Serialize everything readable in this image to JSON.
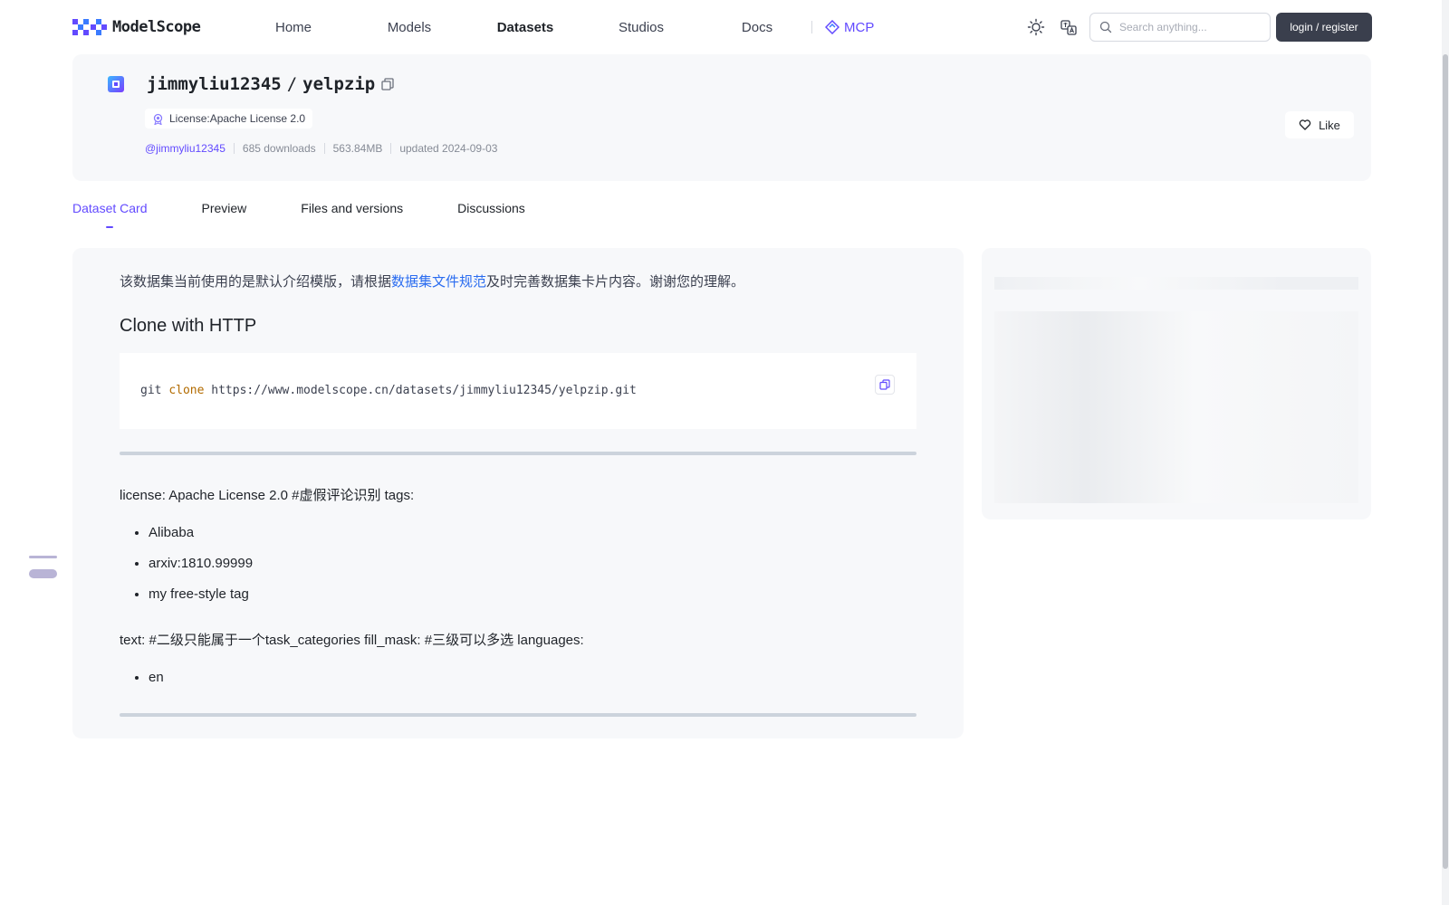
{
  "header": {
    "logo_text": "ModelScope",
    "nav": [
      "Home",
      "Models",
      "Datasets",
      "Studios",
      "Docs"
    ],
    "active_nav": "Datasets",
    "mcp_label": "MCP",
    "search_placeholder": "Search anything...",
    "login_label": "login / register"
  },
  "dataset": {
    "owner": "jimmyliu12345",
    "separator": "/",
    "name": "yelpzip",
    "license_tag": "License:Apache License 2.0",
    "author": "@jimmyliu12345",
    "downloads": "685 downloads",
    "size": "563.84MB",
    "updated": "updated 2024-09-03",
    "like_label": "Like"
  },
  "tabs": [
    "Dataset Card",
    "Preview",
    "Files and versions",
    "Discussions"
  ],
  "card": {
    "notice_before": "该数据集当前使用的是默认介绍模版，请根据",
    "notice_link": "数据集文件规范",
    "notice_after": "及时完善数据集卡片内容。谢谢您的理解。",
    "clone_heading": "Clone with HTTP",
    "code_git": "git",
    "code_clone": "clone",
    "code_url": "https://www.modelscope.cn/datasets/jimmyliu12345/yelpzip.git",
    "license_line": "license: Apache License 2.0 #虚假评论识别 tags:",
    "tags": [
      "Alibaba",
      "arxiv:1810.99999",
      "my free-style tag"
    ],
    "text_line": "text: #二级只能属于一个task_categories fill_mask: #三级可以多选 languages:",
    "languages": [
      "en"
    ]
  },
  "colors": {
    "accent": "#624aff",
    "link": "#2a6cf0",
    "code_keyword": "#b26b00"
  }
}
